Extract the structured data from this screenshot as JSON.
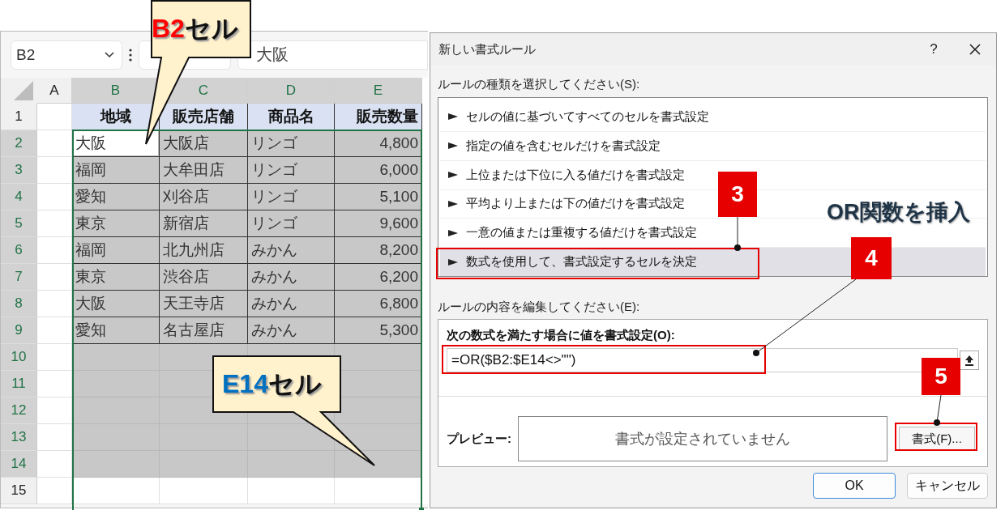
{
  "name_box": {
    "value": "B2"
  },
  "formula_bar": {
    "value": "大阪"
  },
  "sheet": {
    "columns": [
      {
        "label": "A",
        "selected": false
      },
      {
        "label": "B",
        "selected": true
      },
      {
        "label": "C",
        "selected": true
      },
      {
        "label": "D",
        "selected": true
      },
      {
        "label": "E",
        "selected": true
      }
    ],
    "rows": [
      {
        "number": "1",
        "selected": false,
        "kind": "header",
        "cells": [
          {
            "text": "地域",
            "active": false
          },
          {
            "text": "販売店舗",
            "active": false
          },
          {
            "text": "商品名",
            "active": false
          },
          {
            "text": "販売数量",
            "active": false
          }
        ]
      },
      {
        "number": "2",
        "selected": true,
        "kind": "data",
        "cells": [
          {
            "text": "大阪",
            "active": true
          },
          {
            "text": "大阪店",
            "active": false
          },
          {
            "text": "リンゴ",
            "active": false
          },
          {
            "text": "4,800",
            "active": false
          }
        ]
      },
      {
        "number": "3",
        "selected": true,
        "kind": "data",
        "cells": [
          {
            "text": "福岡",
            "active": false
          },
          {
            "text": "大牟田店",
            "active": false
          },
          {
            "text": "リンゴ",
            "active": false
          },
          {
            "text": "6,000",
            "active": false
          }
        ]
      },
      {
        "number": "4",
        "selected": true,
        "kind": "data",
        "cells": [
          {
            "text": "愛知",
            "active": false
          },
          {
            "text": "刈谷店",
            "active": false
          },
          {
            "text": "リンゴ",
            "active": false
          },
          {
            "text": "5,100",
            "active": false
          }
        ]
      },
      {
        "number": "5",
        "selected": true,
        "kind": "data",
        "cells": [
          {
            "text": "東京",
            "active": false
          },
          {
            "text": "新宿店",
            "active": false
          },
          {
            "text": "リンゴ",
            "active": false
          },
          {
            "text": "9,600",
            "active": false
          }
        ]
      },
      {
        "number": "6",
        "selected": true,
        "kind": "data",
        "cells": [
          {
            "text": "福岡",
            "active": false
          },
          {
            "text": "北九州店",
            "active": false
          },
          {
            "text": "みかん",
            "active": false
          },
          {
            "text": "8,200",
            "active": false
          }
        ]
      },
      {
        "number": "7",
        "selected": true,
        "kind": "data",
        "cells": [
          {
            "text": "東京",
            "active": false
          },
          {
            "text": "渋谷店",
            "active": false
          },
          {
            "text": "みかん",
            "active": false
          },
          {
            "text": "6,200",
            "active": false
          }
        ]
      },
      {
        "number": "8",
        "selected": true,
        "kind": "data",
        "cells": [
          {
            "text": "大阪",
            "active": false
          },
          {
            "text": "天王寺店",
            "active": false
          },
          {
            "text": "みかん",
            "active": false
          },
          {
            "text": "6,800",
            "active": false
          }
        ]
      },
      {
        "number": "9",
        "selected": true,
        "kind": "data",
        "cells": [
          {
            "text": "愛知",
            "active": false
          },
          {
            "text": "名古屋店",
            "active": false
          },
          {
            "text": "みかん",
            "active": false
          },
          {
            "text": "5,300",
            "active": false
          }
        ]
      },
      {
        "number": "10",
        "selected": true,
        "kind": "blank"
      },
      {
        "number": "11",
        "selected": true,
        "kind": "blank"
      },
      {
        "number": "12",
        "selected": true,
        "kind": "blank"
      },
      {
        "number": "13",
        "selected": true,
        "kind": "blank"
      },
      {
        "number": "14",
        "selected": true,
        "kind": "blank"
      },
      {
        "number": "15",
        "selected": false,
        "kind": "blank"
      }
    ]
  },
  "dialog": {
    "title": "新しい書式ルール",
    "help": "?",
    "rule_type_label": "ルールの種類を選択してください(S):",
    "rule_types": [
      {
        "label": "セルの値に基づいてすべてのセルを書式設定",
        "selected": false
      },
      {
        "label": "指定の値を含むセルだけを書式設定",
        "selected": false
      },
      {
        "label": "上位または下位に入る値だけを書式設定",
        "selected": false
      },
      {
        "label": "平均より上または下の値だけを書式設定",
        "selected": false
      },
      {
        "label": "一意の値または重複する値だけを書式設定",
        "selected": false
      },
      {
        "label": "数式を使用して、書式設定するセルを決定",
        "selected": true
      }
    ],
    "edit_label": "ルールの内容を編集してください(E):",
    "formula_label": "次の数式を満たす場合に値を書式設定(O):",
    "formula": "=OR($B2:$E14<>\"\")",
    "preview_label": "プレビュー:",
    "preview_text": "書式が設定されていません",
    "format_button": "書式(F)...",
    "buttons": [
      {
        "label": "OK",
        "default": true
      },
      {
        "label": "キャンセル",
        "default": false
      }
    ]
  },
  "annotations": {
    "callouts": [
      {
        "highlight": "B2",
        "text": "セル",
        "color": "#ff0000"
      },
      {
        "highlight": "E14",
        "text": "セル",
        "color": "#0070c0"
      }
    ],
    "steps": [
      {
        "number": "3"
      },
      {
        "number": "4"
      },
      {
        "number": "5"
      }
    ],
    "note": "OR関数を挿入"
  }
}
